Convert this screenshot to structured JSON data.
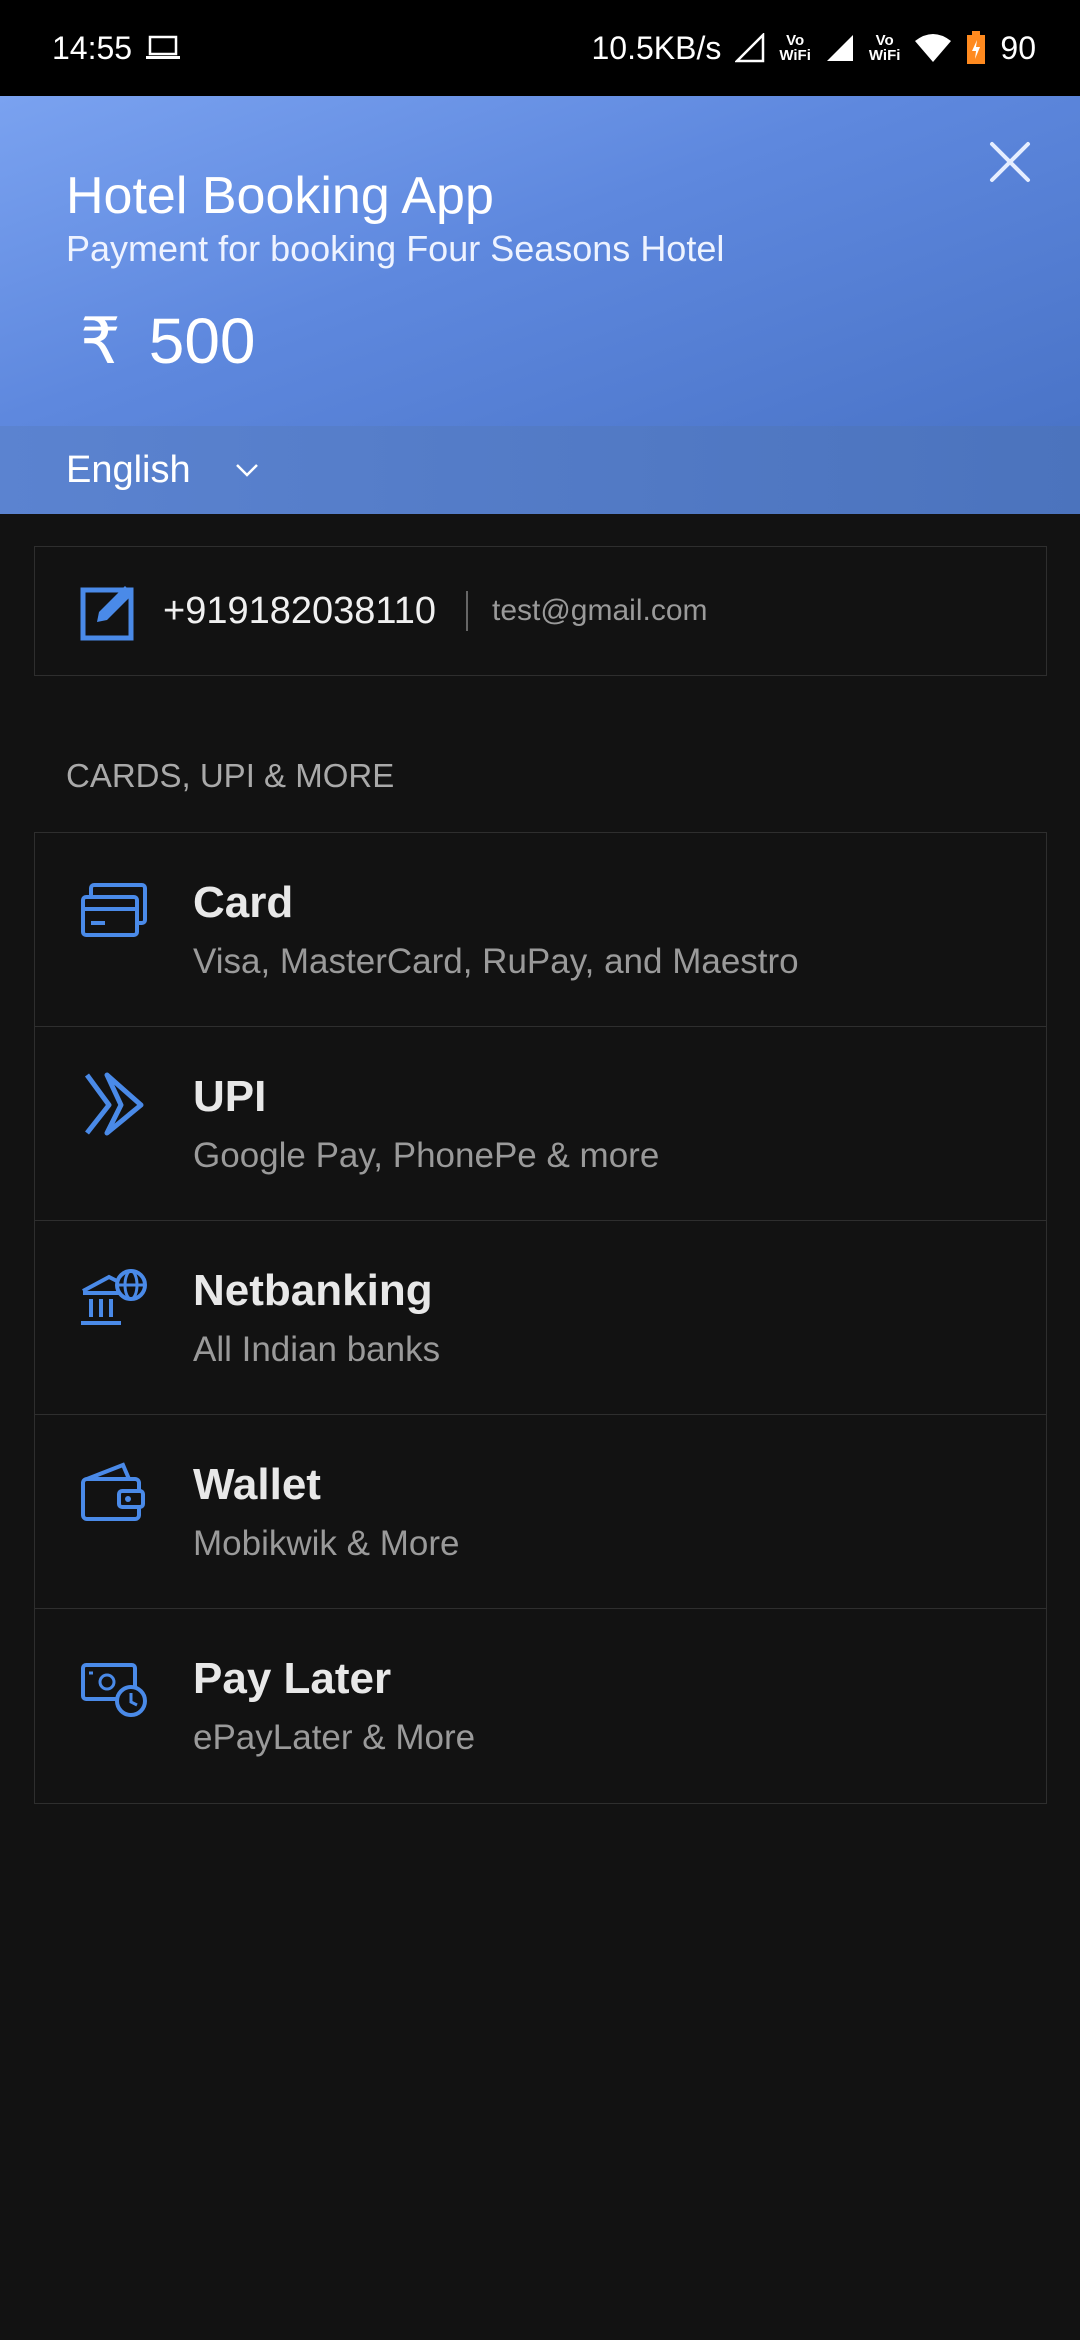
{
  "status_bar": {
    "time": "14:55",
    "speed": "10.5KB/s",
    "vowifi_top": "Vo",
    "vowifi_bottom": "WiFi",
    "battery": "90"
  },
  "header": {
    "title": "Hotel Booking App",
    "subtitle": "Payment for booking Four Seasons Hotel",
    "currency": "₹",
    "amount": "500"
  },
  "language": {
    "selected": "English"
  },
  "contact": {
    "phone": "+919182038110",
    "email": "test@gmail.com"
  },
  "section_label": "CARDS, UPI & MORE",
  "methods": [
    {
      "title": "Card",
      "subtitle": "Visa, MasterCard, RuPay, and Maestro",
      "icon": "card-icon"
    },
    {
      "title": "UPI",
      "subtitle": "Google Pay, PhonePe & more",
      "icon": "upi-icon"
    },
    {
      "title": "Netbanking",
      "subtitle": "All Indian banks",
      "icon": "bank-icon"
    },
    {
      "title": "Wallet",
      "subtitle": "Mobikwik & More",
      "icon": "wallet-icon"
    },
    {
      "title": "Pay Later",
      "subtitle": "ePayLater & More",
      "icon": "pay-later-icon"
    }
  ],
  "colors": {
    "accent": "#4a8ae8",
    "header_start": "#7aa2f0",
    "header_end": "#4a74c8",
    "background": "#121212"
  }
}
